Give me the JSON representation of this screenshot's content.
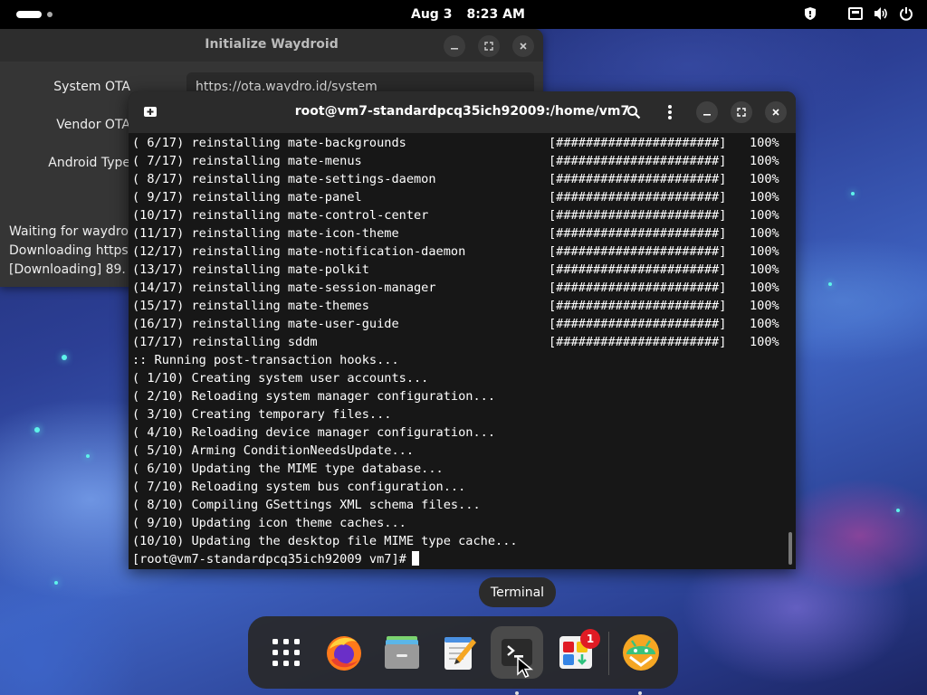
{
  "topbar": {
    "date": "Aug 3",
    "time": "8:23 AM",
    "tray_icons": [
      "shield-icon",
      "network-icon",
      "volume-icon",
      "power-icon"
    ]
  },
  "waydroid": {
    "title": "Initialize Waydroid",
    "labels": [
      "System OTA",
      "Vendor OTA",
      "Android Type"
    ],
    "system_ota_value": "https://ota.waydro.id/system",
    "log": [
      "Waiting for waydroid",
      "Downloading https",
      "[Downloading] 89."
    ]
  },
  "terminal": {
    "title": "root@vm7-standardpcq35ich92009:/home/vm7",
    "progress_lines": [
      {
        "num": "( 6/17)",
        "text": "reinstalling mate-backgrounds",
        "bar": "[######################]",
        "pct": "100%"
      },
      {
        "num": "( 7/17)",
        "text": "reinstalling mate-menus",
        "bar": "[######################]",
        "pct": "100%"
      },
      {
        "num": "( 8/17)",
        "text": "reinstalling mate-settings-daemon",
        "bar": "[######################]",
        "pct": "100%"
      },
      {
        "num": "( 9/17)",
        "text": "reinstalling mate-panel",
        "bar": "[######################]",
        "pct": "100%"
      },
      {
        "num": "(10/17)",
        "text": "reinstalling mate-control-center",
        "bar": "[######################]",
        "pct": "100%"
      },
      {
        "num": "(11/17)",
        "text": "reinstalling mate-icon-theme",
        "bar": "[######################]",
        "pct": "100%"
      },
      {
        "num": "(12/17)",
        "text": "reinstalling mate-notification-daemon",
        "bar": "[######################]",
        "pct": "100%"
      },
      {
        "num": "(13/17)",
        "text": "reinstalling mate-polkit",
        "bar": "[######################]",
        "pct": "100%"
      },
      {
        "num": "(14/17)",
        "text": "reinstalling mate-session-manager",
        "bar": "[######################]",
        "pct": "100%"
      },
      {
        "num": "(15/17)",
        "text": "reinstalling mate-themes",
        "bar": "[######################]",
        "pct": "100%"
      },
      {
        "num": "(16/17)",
        "text": "reinstalling mate-user-guide",
        "bar": "[######################]",
        "pct": "100%"
      },
      {
        "num": "(17/17)",
        "text": "reinstalling sddm",
        "bar": "[######################]",
        "pct": "100%"
      }
    ],
    "plain_lines": [
      ":: Running post-transaction hooks...",
      "( 1/10) Creating system user accounts...",
      "( 2/10) Reloading system manager configuration...",
      "( 3/10) Creating temporary files...",
      "( 4/10) Reloading device manager configuration...",
      "( 5/10) Arming ConditionNeedsUpdate...",
      "( 6/10) Updating the MIME type database...",
      "( 7/10) Reloading system bus configuration...",
      "( 8/10) Compiling GSettings XML schema files...",
      "( 9/10) Updating icon theme caches...",
      "(10/10) Updating the desktop file MIME type cache..."
    ],
    "prompt": "[root@vm7-standardpcq35ich92009 vm7]#"
  },
  "tooltip": "Terminal",
  "dock": {
    "items": [
      "app-grid-icon",
      "firefox-icon",
      "files-icon",
      "text-editor-icon",
      "terminal-icon",
      "software-icon",
      "waydroid-icon"
    ],
    "software_badge": "1"
  }
}
